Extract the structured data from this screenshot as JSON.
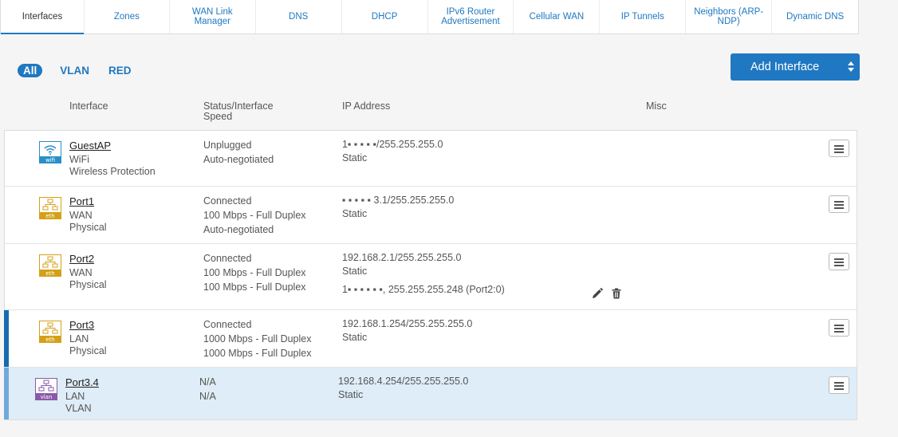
{
  "tabs": [
    {
      "label": "Interfaces",
      "active": true
    },
    {
      "label": "Zones"
    },
    {
      "label": "WAN Link Manager"
    },
    {
      "label": "DNS"
    },
    {
      "label": "DHCP"
    },
    {
      "label": "IPv6 Router Advertisement"
    },
    {
      "label": "Cellular WAN"
    },
    {
      "label": "IP Tunnels"
    },
    {
      "label": "Neighbors (ARP-NDP)"
    },
    {
      "label": "Dynamic DNS"
    }
  ],
  "filters": [
    "All",
    "VLAN",
    "RED"
  ],
  "add_button": "Add Interface",
  "columns": {
    "interface": "Interface",
    "status": "Status/Interface Speed",
    "ip": "IP Address",
    "misc": "Misc"
  },
  "rows": [
    {
      "name": "GuestAP",
      "icon": "wifi-icon",
      "icon_tag": "wifi",
      "zone": "WiFi",
      "type": "Wireless Protection",
      "status": [
        "Unplugged",
        "Auto-negotiated"
      ],
      "ip": [
        "1▪ ▪ ▪ ▪ ▪/255.255.255.0",
        "Static"
      ]
    },
    {
      "name": "Port1",
      "icon": "ethernet-icon",
      "icon_tag": "eth",
      "zone": "WAN",
      "type": "Physical",
      "status": [
        "Connected",
        "100 Mbps - Full Duplex",
        "Auto-negotiated"
      ],
      "ip": [
        "▪ ▪ ▪ ▪ ▪ 3.1/255.255.255.0",
        "Static"
      ]
    },
    {
      "name": "Port2",
      "icon": "ethernet-icon",
      "icon_tag": "eth",
      "zone": "WAN",
      "type": "Physical",
      "status": [
        "Connected",
        "100 Mbps - Full Duplex",
        "100 Mbps - Full Duplex"
      ],
      "ip": [
        "192.168.2.1/255.255.255.0",
        "Static",
        "1▪ ▪ ▪ ▪ ▪ ▪, 255.255.255.248 (Port2:0)"
      ]
    },
    {
      "name": "Port3",
      "icon": "ethernet-icon",
      "icon_tag": "eth",
      "zone": "LAN",
      "type": "Physical",
      "status": [
        "Connected",
        "1000 Mbps - Full Duplex",
        "1000 Mbps - Full Duplex"
      ],
      "ip": [
        "192.168.1.254/255.255.255.0",
        "Static"
      ]
    },
    {
      "name": "Port3.4",
      "icon": "vlan-icon",
      "icon_tag": "vlan",
      "zone": "LAN",
      "type": "VLAN",
      "status": [
        "N/A",
        "N/A"
      ],
      "ip": [
        "192.168.4.254/255.255.255.0",
        "Static"
      ]
    }
  ],
  "colors": {
    "accent": "#1f78c1",
    "eth_icon": "#d4a017",
    "wifi_icon": "#2a8fc7",
    "vlan_icon": "#8a5aa8",
    "selected_row": "#deedf7"
  }
}
